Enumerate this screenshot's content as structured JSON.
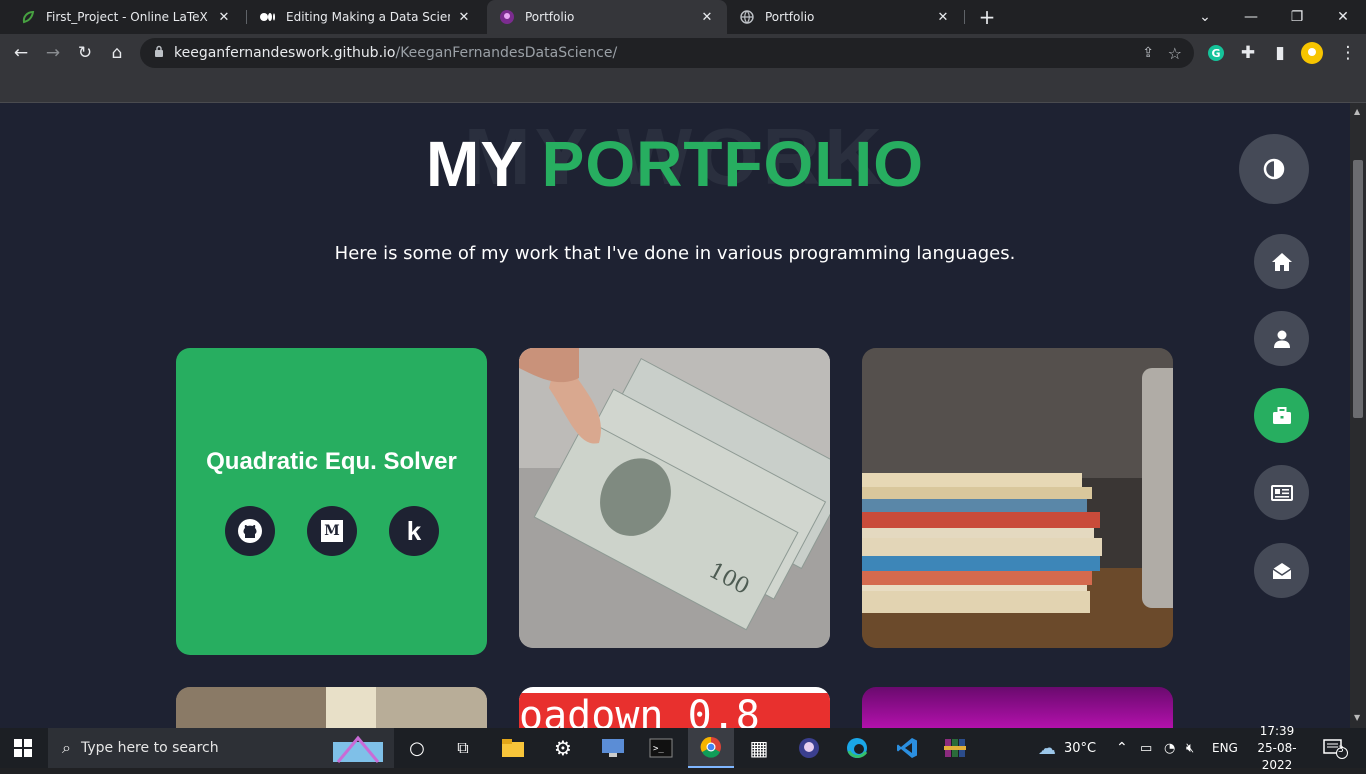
{
  "browser": {
    "tabs": [
      {
        "label": "First_Project - Online LaTeX Edito",
        "icon": "overleaf-icon"
      },
      {
        "label": "Editing Making a Data Science Po",
        "icon": "medium-icon"
      },
      {
        "label": "Portfolio",
        "icon": "portfolio-icon"
      },
      {
        "label": "Portfolio",
        "icon": "globe-icon"
      }
    ],
    "new_tab": "+",
    "url_host": "keeganfernandeswork.github.io",
    "url_path": "/KeeganFernandesDataScience/"
  },
  "page": {
    "bg_word": "MY WORK",
    "title_white": "MY",
    "title_green": "PORTFOLIO",
    "subtitle": "Here is some of my work that I've done in various programming languages.",
    "card1_title": "Quadratic Equ. Solver",
    "card1_links": [
      "github-icon",
      "medium-icon",
      "kaggle-icon"
    ],
    "kaggle_letter": "k",
    "medium_letter": "M",
    "card5_text": "oadown 0.8",
    "colors": {
      "accent": "#27ae60",
      "background": "#1e2232",
      "nav": "#454a57"
    }
  },
  "sidenav": [
    "theme-toggle-icon",
    "home-icon",
    "user-icon",
    "briefcase-icon",
    "blog-icon",
    "contact-icon"
  ],
  "taskbar": {
    "search_placeholder": "Type here to search",
    "weather": "30°C",
    "lang": "ENG",
    "time": "17:39",
    "date": "25-08-2022",
    "notifications": "3"
  }
}
